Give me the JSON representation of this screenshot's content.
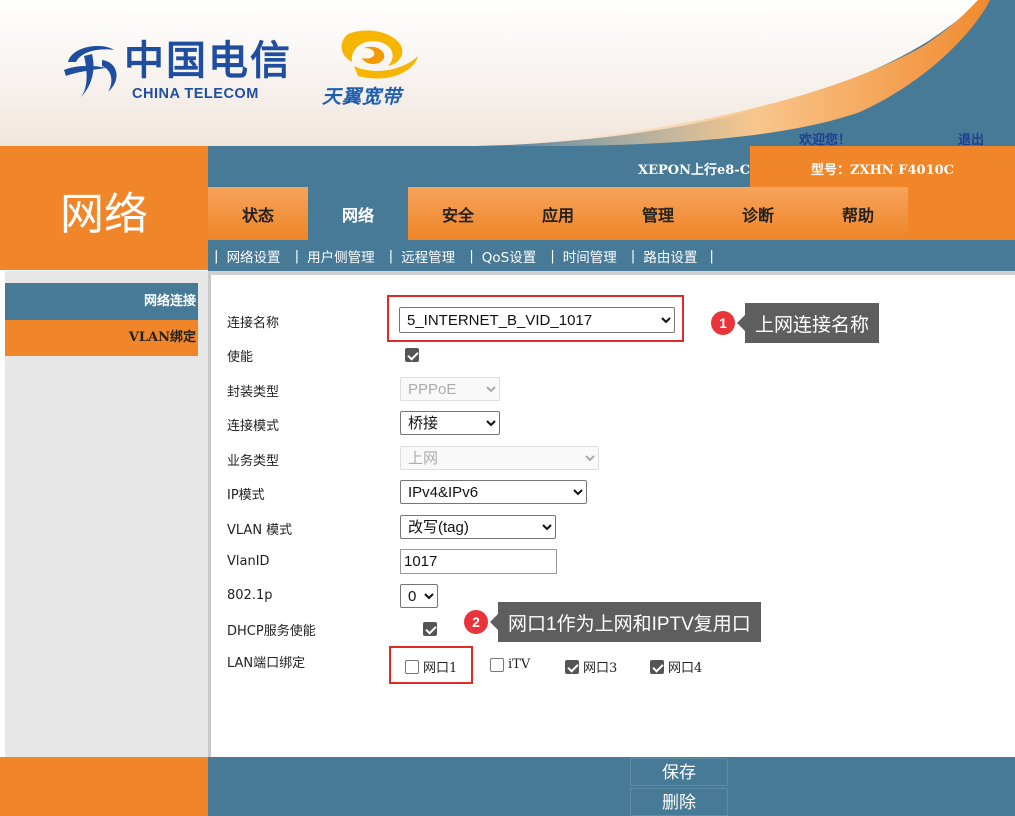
{
  "header": {
    "brand_cn": "中国电信",
    "brand_en": "CHINA TELECOM",
    "sub_brand": "天翼宽带",
    "welcome": "欢迎您！",
    "logout": "退出",
    "uplink": "XEPON上行e8-C",
    "model": "型号：ZXHN F4010C"
  },
  "section_title": "网络",
  "main_tabs": [
    {
      "label": "状态",
      "active": false
    },
    {
      "label": "网络",
      "active": true
    },
    {
      "label": "安全",
      "active": false
    },
    {
      "label": "应用",
      "active": false
    },
    {
      "label": "管理",
      "active": false
    },
    {
      "label": "诊断",
      "active": false
    },
    {
      "label": "帮助",
      "active": false
    }
  ],
  "sub_nav": [
    "网络设置",
    "用户侧管理",
    "远程管理",
    "QoS设置",
    "时间管理",
    "路由设置"
  ],
  "sidebar": {
    "items": [
      {
        "label": "网络连接",
        "active": true
      },
      {
        "label": "VLAN绑定",
        "active": false
      }
    ]
  },
  "form": {
    "connection_name": {
      "label": "连接名称",
      "value": "5_INTERNET_B_VID_1017"
    },
    "enable": {
      "label": "使能",
      "checked": true
    },
    "encap_type": {
      "label": "封装类型",
      "value": "PPPoE"
    },
    "conn_mode": {
      "label": "连接模式",
      "value": "桥接"
    },
    "service_type": {
      "label": "业务类型",
      "value": "上网"
    },
    "ip_mode": {
      "label": "IP模式",
      "value": "IPv4&IPv6"
    },
    "vlan_mode": {
      "label": "VLAN 模式",
      "value": "改写(tag)"
    },
    "vlan_id": {
      "label": "VlanID",
      "value": "1017"
    },
    "dot1p": {
      "label": "802.1p",
      "value": "0"
    },
    "dhcp_enable": {
      "label": "DHCP服务使能",
      "checked": true
    },
    "lan_bind": {
      "label": "LAN端口绑定",
      "ports": [
        {
          "label": "网口1",
          "checked": false
        },
        {
          "label": "iTV",
          "checked": false
        },
        {
          "label": "网口3",
          "checked": true
        },
        {
          "label": "网口4",
          "checked": true
        }
      ]
    }
  },
  "annotations": [
    {
      "number": "1",
      "text": "上网连接名称"
    },
    {
      "number": "2",
      "text": "网口1作为上网和IPTV复用口"
    }
  ],
  "footer": {
    "save": "保存",
    "delete": "删除"
  },
  "colors": {
    "orange": "#f0852a",
    "steel_blue": "#467a97",
    "brand_blue": "#1f4ea1",
    "annotation_red": "#e02a2a"
  }
}
